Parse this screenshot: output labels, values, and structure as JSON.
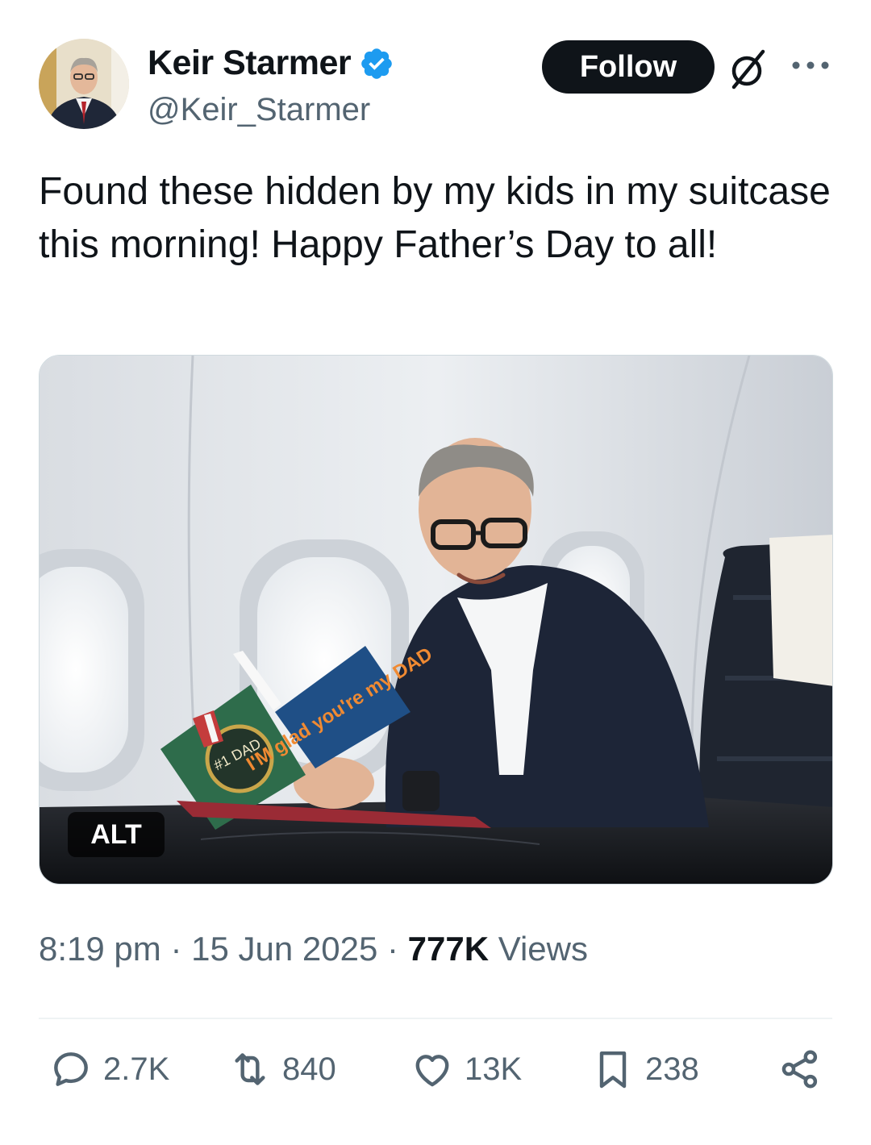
{
  "author": {
    "display_name": "Keir Starmer",
    "handle": "@Keir_Starmer",
    "verified": true,
    "verified_color": "#1d9bf0"
  },
  "follow_button": {
    "label": "Follow"
  },
  "icons": {
    "grok": "grok-icon",
    "more": "more-options-icon"
  },
  "tweet": {
    "text": "Found these hidden by my kids in my suitcase this morning! Happy Father’s Day to all!",
    "media": {
      "alt_badge": "ALT",
      "card_medal_text": "#1 DAD",
      "card_blue_text": "I'M glad you're my DAD"
    }
  },
  "meta": {
    "time": "8:19 pm",
    "date": "15 Jun 2025",
    "views_count": "777K",
    "views_label": "Views"
  },
  "actions": {
    "replies": "2.7K",
    "reposts": "840",
    "likes": "13K",
    "bookmarks": "238"
  }
}
